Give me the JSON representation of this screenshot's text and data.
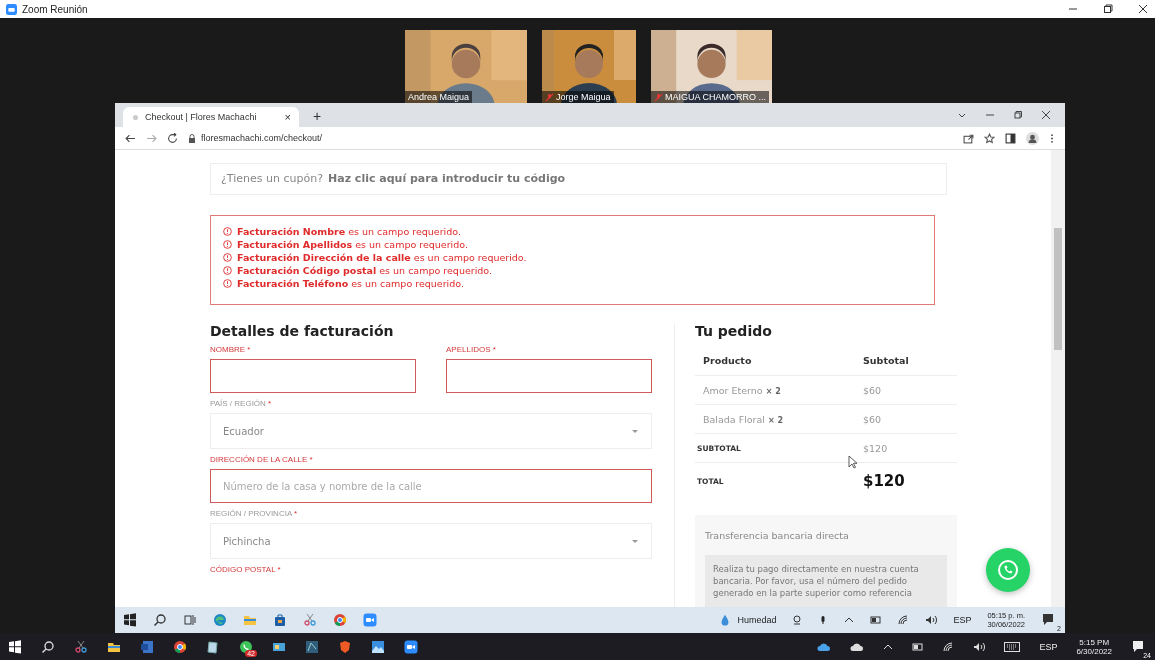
{
  "window": {
    "title": "Zoom Reunión"
  },
  "participants": [
    {
      "name": "Andrea Maigua",
      "muted": false,
      "kind": "picture"
    },
    {
      "name": "Jorge Maigua",
      "muted": true,
      "kind": "picture"
    },
    {
      "name": "MAIGUA CHAMORRO ...",
      "muted": true,
      "kind": "picture"
    }
  ],
  "browser": {
    "tab": {
      "title": "Checkout | Flores Machachi",
      "close": "×"
    },
    "new_tab": "+",
    "address": "floresmachachi.com/checkout/"
  },
  "coupon": {
    "text": "¿Tienes un cupón?",
    "link": "Haz clic aquí para introducir tu código"
  },
  "errors": [
    "**Facturación Nombre** es un campo requerido.",
    "**Facturación Apellidos** es un campo requerido.",
    "**Facturación Dirección de la calle** es un campo requerido.",
    "**Facturación Código postal** es un campo requerido.",
    "**Facturación Teléfono** es un campo requerido."
  ],
  "billing": {
    "title": "Detalles de facturación",
    "required_mark": "*",
    "rows": [
      [
        {
          "label": "NOMBRE",
          "kind": "input",
          "error": true
        },
        {
          "label": "APELLIDOS",
          "kind": "input",
          "error": true
        }
      ],
      [
        {
          "label": "PAÍS / REGIÓN",
          "kind": "select",
          "error": false,
          "value": "Ecuador"
        }
      ],
      [
        {
          "label": "DIRECCIÓN DE LA CALLE",
          "kind": "input",
          "error": true,
          "placeholder": "Número de la casa y nombre de la calle"
        }
      ],
      [
        {
          "label": "REGIÓN / PROVINCIA",
          "kind": "select",
          "error": false,
          "value": "Pichincha"
        }
      ],
      [
        {
          "label": "CÓDIGO POSTAL",
          "kind": "label",
          "error": true
        }
      ]
    ]
  },
  "order": {
    "title": "Tu pedido",
    "columns": [
      "Producto",
      "Subtotal"
    ],
    "items": [
      {
        "name": "Amor Eterno",
        "qty": "× 2",
        "subtotal": "$60"
      },
      {
        "name": "Balada Floral",
        "qty": "× 2",
        "subtotal": "$60"
      }
    ],
    "subtotal": {
      "label": "SUBTOTAL",
      "value": "$120"
    },
    "total": {
      "label": "TOTAL",
      "value": "$120"
    },
    "payment": {
      "title": "Transferencia bancaria directa",
      "description": "Realiza tu pago directamente en nuestra cuenta bancaria. Por favor, usa el número del pedido generado en la parte superior como referencia"
    }
  },
  "inner_taskbar": {
    "weather": "Humedad",
    "language": "ESP",
    "time": "05:15 p. m.",
    "date": "30/06/2022",
    "notifications": "2"
  },
  "outer_taskbar": {
    "chat_badge": "42",
    "language": "ESP",
    "time": "5:15 PM",
    "date": "6/30/2022",
    "notifications": "24"
  }
}
